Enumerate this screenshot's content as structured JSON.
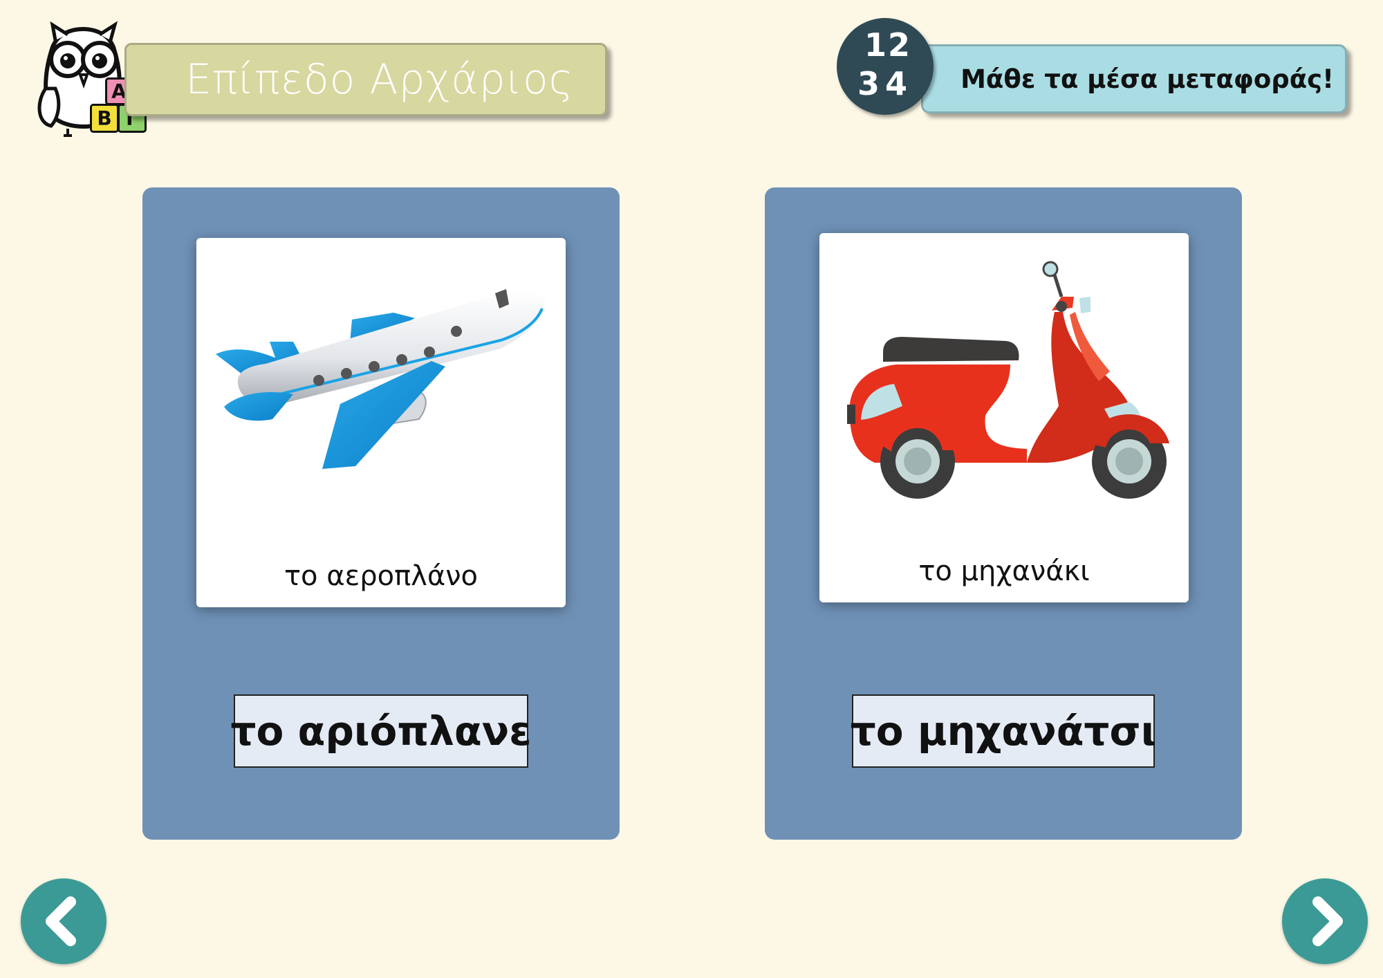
{
  "header": {
    "level_title": "Επίπεδο Αρχάριος",
    "subtitle": "Μάθε τα μέσα μεταφοράς!",
    "logo_blocks": [
      "Α",
      "Β",
      "Γ"
    ],
    "number_badge": [
      "1",
      "2",
      "3",
      "4"
    ]
  },
  "cards": [
    {
      "icon": "airplane-icon",
      "caption": "το αεροπλάνο",
      "dialect_word": "το αριόπλανε"
    },
    {
      "icon": "scooter-icon",
      "caption": "το μηχανάκι",
      "dialect_word": "το μηχανάτσι"
    }
  ],
  "navigation": {
    "prev_icon": "chevron-left-icon",
    "next_icon": "chevron-right-icon"
  },
  "colors": {
    "background": "#fdf8e6",
    "card": "#6f91b6",
    "level_banner": "#d7d8a0",
    "info_banner": "#a9dde3",
    "badge": "#2f4a55",
    "nav_button": "#3b9a95"
  }
}
